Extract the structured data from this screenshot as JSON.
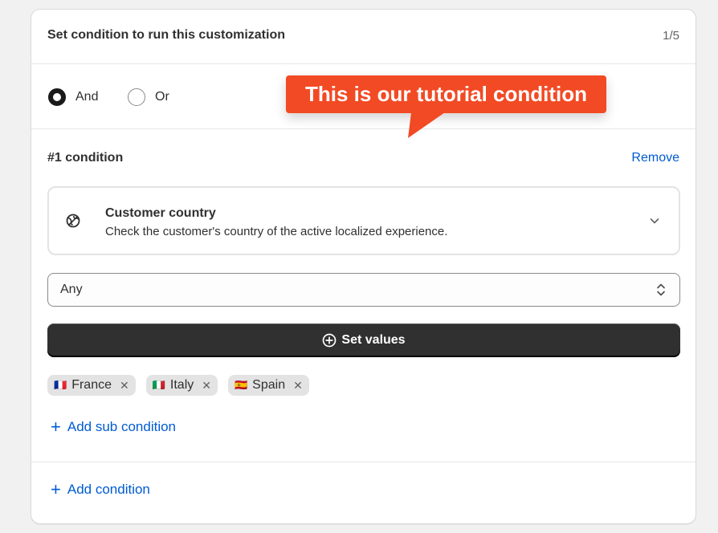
{
  "header": {
    "title": "Set condition to run this customization",
    "step": "1/5"
  },
  "logic": {
    "options": [
      {
        "label": "And",
        "checked": true
      },
      {
        "label": "Or",
        "checked": false
      }
    ]
  },
  "condition": {
    "title": "#1 condition",
    "remove_label": "Remove",
    "rule": {
      "icon": "globe-off-icon",
      "name": "Customer country",
      "description": "Check the customer's country of the active localized experience."
    },
    "operator": {
      "value": "Any"
    },
    "set_values_label": "Set values",
    "values": [
      {
        "flag": "🇫🇷",
        "label": "France"
      },
      {
        "flag": "🇮🇹",
        "label": "Italy"
      },
      {
        "flag": "🇪🇸",
        "label": "Spain"
      }
    ],
    "add_sub_condition_label": "Add sub condition"
  },
  "add_condition_label": "Add condition",
  "callout": {
    "text": "This is our tutorial condition",
    "color": "#f24a24"
  },
  "colors": {
    "link": "#005bd3",
    "primary_button": "#303030"
  }
}
